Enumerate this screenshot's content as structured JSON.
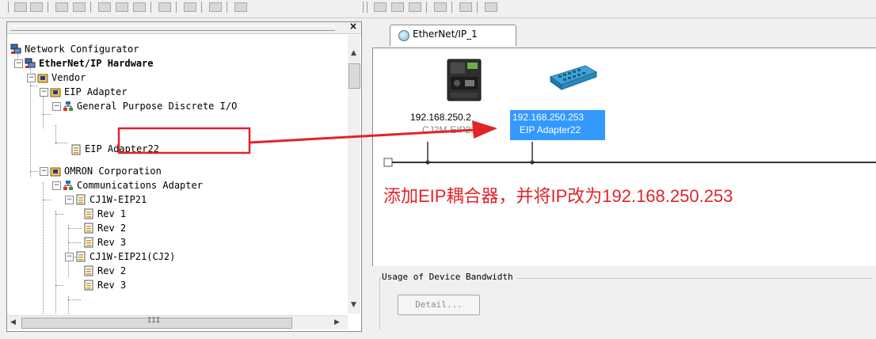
{
  "pane": {
    "close_glyph": "×"
  },
  "tree": {
    "items": [
      {
        "label": "Network Configurator"
      },
      {
        "label": "EtherNet/IP Hardware"
      },
      {
        "label": "Vendor"
      },
      {
        "label": "EIP Adapter"
      },
      {
        "label": "General Purpose Discrete I/O"
      },
      {
        "label": "EIP Adapter22"
      },
      {
        "label": "OMRON Corporation"
      },
      {
        "label": "Communications Adapter"
      },
      {
        "label": "CJ1W-EIP21"
      },
      {
        "label": "Rev 1"
      },
      {
        "label": "Rev 2"
      },
      {
        "label": "Rev 3"
      },
      {
        "label": "CJ1W-EIP21(CJ2)"
      },
      {
        "label": "Rev 2"
      },
      {
        "label": "Rev 3"
      }
    ],
    "hscroll_thumb_glyph": "III"
  },
  "network_tab": {
    "label": "EtherNet/IP_1"
  },
  "devices": [
    {
      "ip": "192.168.250.2",
      "name": "CJ2M-EIP21"
    },
    {
      "ip": "192.168.250.253",
      "name": "EIP Adapter22"
    }
  ],
  "bandwidth": {
    "title": "Usage of Device Bandwidth",
    "detail_button": "Detail..."
  },
  "annotation": {
    "text": "添加EIP耦合器，并将IP改为192.168.250.253"
  },
  "colors": {
    "annotation_red": "#e0242a",
    "selection_blue": "#3399ff",
    "device_blue": "#2e8fc6"
  }
}
